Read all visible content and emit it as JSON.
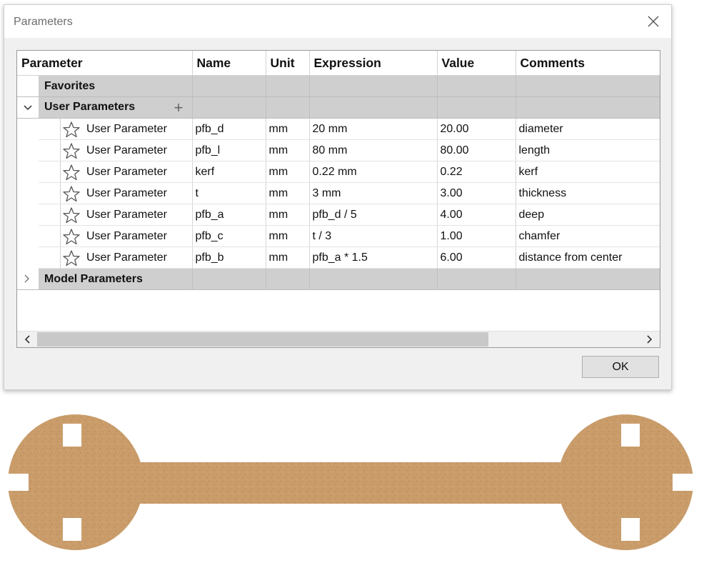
{
  "dialog": {
    "title": "Parameters",
    "ok_label": "OK"
  },
  "columns": [
    "Parameter",
    "Name",
    "Unit",
    "Expression",
    "Value",
    "Comments"
  ],
  "groups": {
    "favorites": "Favorites",
    "user_parameters": "User Parameters",
    "model_parameters": "Model Parameters"
  },
  "user_parameters": [
    {
      "type": "User Parameter",
      "name": "pfb_d",
      "unit": "mm",
      "expression": "20 mm",
      "value": "20.00",
      "comment": "diameter"
    },
    {
      "type": "User Parameter",
      "name": "pfb_l",
      "unit": "mm",
      "expression": "80 mm",
      "value": "80.00",
      "comment": "length"
    },
    {
      "type": "User Parameter",
      "name": "kerf",
      "unit": "mm",
      "expression": "0.22 mm",
      "value": "0.22",
      "comment": "kerf"
    },
    {
      "type": "User Parameter",
      "name": "t",
      "unit": "mm",
      "expression": "3 mm",
      "value": "3.00",
      "comment": "thickness"
    },
    {
      "type": "User Parameter",
      "name": "pfb_a",
      "unit": "mm",
      "expression": "pfb_d / 5",
      "value": "4.00",
      "comment": "deep"
    },
    {
      "type": "User Parameter",
      "name": "pfb_c",
      "unit": "mm",
      "expression": "t / 3",
      "value": "1.00",
      "comment": "chamfer"
    },
    {
      "type": "User Parameter",
      "name": "pfb_b",
      "unit": "mm",
      "expression": "pfb_a * 1.5",
      "value": "6.00",
      "comment": "distance from center"
    }
  ],
  "icons": {
    "close": "close-icon",
    "expand": "chevron-down-icon",
    "collapsed": "chevron-right-icon",
    "add": "plus-icon",
    "favorite": "star-outline-icon",
    "scroll_left": "scroll-left-icon",
    "scroll_right": "scroll-right-icon"
  },
  "colors": {
    "group_row": "#cfcfcf",
    "dialog_bg": "#f0f0f0",
    "wood": "#c99c6a"
  }
}
